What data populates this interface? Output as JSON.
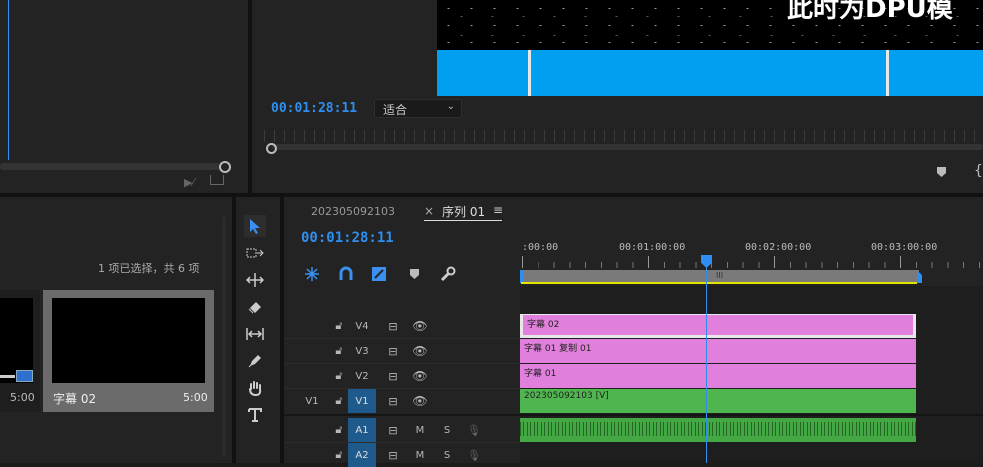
{
  "source_monitor": {},
  "program_monitor": {
    "timecode": "00:01:28:11",
    "fit_label": "适合",
    "video_text": "此时为DPU模"
  },
  "project_panel": {
    "selection_status": "1 项已选择，共 6 项",
    "items": [
      {
        "name": "",
        "duration": "5:00"
      },
      {
        "name": "字幕 02",
        "duration": "5:00"
      }
    ]
  },
  "tools": [
    {
      "name": "selection-tool",
      "icon": "arrow-icon"
    },
    {
      "name": "track-select-forward-tool",
      "icon": "track-select-icon"
    },
    {
      "name": "ripple-edit-tool",
      "icon": "ripple-icon"
    },
    {
      "name": "razor-tool",
      "icon": "razor-icon"
    },
    {
      "name": "slip-tool",
      "icon": "slip-icon"
    },
    {
      "name": "pen-tool",
      "icon": "pen-icon"
    },
    {
      "name": "hand-tool",
      "icon": "hand-icon"
    },
    {
      "name": "type-tool",
      "icon": "type-icon"
    }
  ],
  "timeline": {
    "tabs": [
      {
        "label": "202305092103"
      },
      {
        "label": "序列 01",
        "active": true
      }
    ],
    "close_glyph": "×",
    "menu_glyph": "≡",
    "timecode": "00:01:28:11",
    "ruler_labels": [
      ":00:00",
      "00:01:00:00",
      "00:02:00:00",
      "00:03:00:00"
    ],
    "work_area_glyph": "III",
    "tracks": [
      {
        "id": "V4",
        "label": "V4",
        "clip": "字幕 02",
        "type": "graphic-selected"
      },
      {
        "id": "V3",
        "label": "V3",
        "clip": "字幕 01 复制 01",
        "type": "graphic"
      },
      {
        "id": "V2",
        "label": "V2",
        "clip": "字幕 01",
        "type": "graphic"
      },
      {
        "id": "V1",
        "label": "V1",
        "source_patch": "V1",
        "clip": "202305092103 [V]",
        "type": "video"
      },
      {
        "id": "A1",
        "label": "A1",
        "m": "M",
        "s": "S",
        "type": "audio"
      },
      {
        "id": "A2",
        "label": "A2",
        "m": "M",
        "s": "S",
        "type": "audio"
      }
    ],
    "colors": {
      "graphic": "#e07fdc",
      "video": "#4fb64f",
      "audio": "#43a843",
      "accent": "#2e8ff0"
    }
  }
}
